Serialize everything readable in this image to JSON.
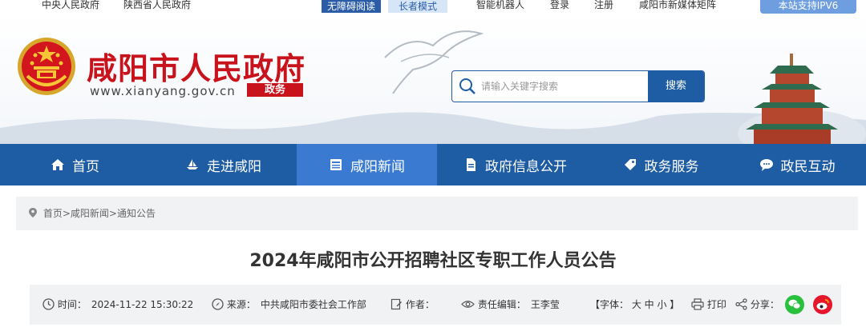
{
  "topbar": {
    "links": [
      "中央人民政府",
      "陕西省人民政府"
    ],
    "accessibility": "无障碍阅读",
    "elder_mode": "长者模式",
    "robot": "智能机器人",
    "login": "登录",
    "register": "注册",
    "media": "咸阳市新媒体矩阵",
    "ipv6": "本站支持IPV6"
  },
  "header": {
    "title": "咸阳市人民政府",
    "url": "www.xianyang.gov.cn",
    "tag": "政务"
  },
  "search": {
    "placeholder": "请输入关键字搜索",
    "button": "搜索"
  },
  "nav": [
    {
      "label": "首页",
      "icon": "home-icon"
    },
    {
      "label": "走进咸阳",
      "icon": "boat-icon"
    },
    {
      "label": "咸阳新闻",
      "icon": "news-icon",
      "active": true
    },
    {
      "label": "政府信息公开",
      "icon": "document-icon"
    },
    {
      "label": "政务服务",
      "icon": "tag-icon"
    },
    {
      "label": "政民互动",
      "icon": "chat-icon"
    }
  ],
  "breadcrumb": "首页>咸阳新闻>通知公告",
  "article": {
    "title": "2024年咸阳市公开招聘社区专职工作人员公告"
  },
  "meta": {
    "time_label": "时间：",
    "time": "2024-11-22 15:30:22",
    "source_label": "来源：",
    "source": "中共咸阳市委社会工作部",
    "author_label": "作者：",
    "editor_label": "责任编辑：",
    "editor": "王李莹",
    "font_size": "【字体：  大  中  小 】",
    "print": "打印",
    "share": "分享："
  },
  "colors": {
    "brand_red": "#c8121c",
    "nav_blue": "#1e5ca3",
    "nav_active": "#3a7bd1"
  }
}
